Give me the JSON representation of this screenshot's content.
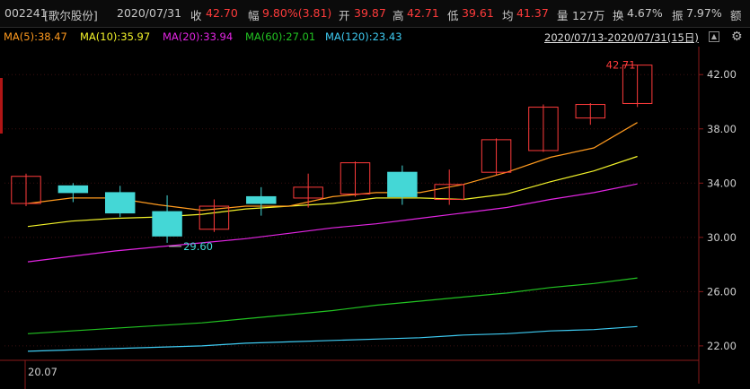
{
  "header": {
    "code": "002241",
    "name": "[歌尔股份]",
    "date": "2020/07/31",
    "close_label": "收",
    "close": "42.70",
    "change_label": "幅",
    "change": "9.80%(3.81)",
    "open_label": "开",
    "open": "39.87",
    "high_label": "高",
    "high": "42.71",
    "low_label": "低",
    "low": "39.61",
    "avg_label": "均",
    "avg": "41.37",
    "vol_label": "量",
    "vol": "127万",
    "turnover_label": "换",
    "turnover": "4.67%",
    "amp_label": "振",
    "amp": "7.97%",
    "amount_label": "额"
  },
  "ma_bar": {
    "ma5": "MA(5):38.47",
    "ma10": "MA(10):35.97",
    "ma20": "MA(20):33.94",
    "ma60": "MA(60):27.01",
    "ma120": "MA(120):23.43",
    "range": "2020/07/13-2020/07/31(15日)",
    "caret": "▲",
    "gear": "⚙"
  },
  "colors": {
    "up": "#ff3b3b",
    "down": "#44d7d6",
    "ma5": "#ff9a1e",
    "ma10": "#f4f42a",
    "ma20": "#e325e3",
    "ma60": "#22c322",
    "ma120": "#3ecbf2",
    "grid": "#3a1010"
  },
  "chart_data": {
    "type": "candlestick",
    "x_label_start": "20.07",
    "y_ticks": [
      "42.00",
      "38.00",
      "34.00",
      "30.00",
      "26.00",
      "22.00"
    ],
    "ylim": [
      21.2,
      43.8
    ],
    "candles": [
      {
        "open": 32.5,
        "close": 34.5,
        "high": 34.7,
        "low": 32.3
      },
      {
        "open": 33.8,
        "close": 33.3,
        "high": 34.0,
        "low": 32.6
      },
      {
        "open": 33.3,
        "close": 31.8,
        "high": 33.8,
        "low": 31.5
      },
      {
        "open": 31.9,
        "close": 30.1,
        "high": 33.1,
        "low": 29.6
      },
      {
        "open": 30.6,
        "close": 32.3,
        "high": 32.8,
        "low": 30.4
      },
      {
        "open": 33.0,
        "close": 32.5,
        "high": 33.7,
        "low": 31.6
      },
      {
        "open": 32.9,
        "close": 33.7,
        "high": 34.7,
        "low": 32.2
      },
      {
        "open": 33.2,
        "close": 35.5,
        "high": 35.6,
        "low": 33.0
      },
      {
        "open": 34.8,
        "close": 33.0,
        "high": 35.3,
        "low": 32.4
      },
      {
        "open": 32.8,
        "close": 33.9,
        "high": 35.0,
        "low": 32.4
      },
      {
        "open": 34.8,
        "close": 37.2,
        "high": 37.3,
        "low": 34.6
      },
      {
        "open": 36.4,
        "close": 39.6,
        "high": 39.8,
        "low": 36.3
      },
      {
        "open": 38.8,
        "close": 39.8,
        "high": 39.9,
        "low": 38.3
      },
      {
        "open": 39.87,
        "close": 42.7,
        "high": 42.71,
        "low": 39.61
      }
    ],
    "ma": {
      "ma5": [
        32.5,
        32.9,
        32.9,
        32.4,
        32.0,
        32.3,
        32.3,
        33.0,
        33.3,
        33.3,
        33.9,
        34.8,
        35.9,
        36.6,
        38.47
      ],
      "ma10": [
        30.8,
        31.2,
        31.4,
        31.5,
        31.7,
        32.1,
        32.3,
        32.5,
        32.9,
        32.9,
        32.8,
        33.2,
        34.1,
        34.9,
        35.97
      ],
      "ma20": [
        28.2,
        28.6,
        29.0,
        29.3,
        29.6,
        29.9,
        30.3,
        30.7,
        31.0,
        31.4,
        31.8,
        32.2,
        32.8,
        33.3,
        33.94
      ],
      "ma60": [
        22.9,
        23.1,
        23.3,
        23.5,
        23.7,
        24.0,
        24.3,
        24.6,
        25.0,
        25.3,
        25.6,
        25.9,
        26.3,
        26.6,
        27.01
      ],
      "ma120": [
        21.6,
        21.7,
        21.8,
        21.9,
        22.0,
        22.2,
        22.3,
        22.4,
        22.5,
        22.6,
        22.8,
        22.9,
        23.1,
        23.2,
        23.43
      ]
    },
    "annotations": {
      "high_label": "42.71",
      "low_label": "29.60"
    }
  }
}
